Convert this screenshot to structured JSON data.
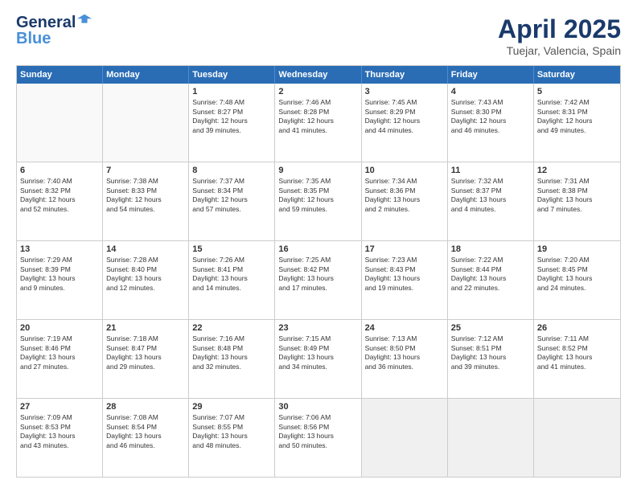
{
  "header": {
    "logo_line1_dark": "General",
    "logo_line2_blue": "Blue",
    "title": "April 2025",
    "subtitle": "Tuejar, Valencia, Spain"
  },
  "calendar": {
    "days": [
      "Sunday",
      "Monday",
      "Tuesday",
      "Wednesday",
      "Thursday",
      "Friday",
      "Saturday"
    ],
    "rows": [
      [
        {
          "day": "",
          "empty": true
        },
        {
          "day": "",
          "empty": true
        },
        {
          "day": "1",
          "lines": [
            "Sunrise: 7:48 AM",
            "Sunset: 8:27 PM",
            "Daylight: 12 hours",
            "and 39 minutes."
          ]
        },
        {
          "day": "2",
          "lines": [
            "Sunrise: 7:46 AM",
            "Sunset: 8:28 PM",
            "Daylight: 12 hours",
            "and 41 minutes."
          ]
        },
        {
          "day": "3",
          "lines": [
            "Sunrise: 7:45 AM",
            "Sunset: 8:29 PM",
            "Daylight: 12 hours",
            "and 44 minutes."
          ]
        },
        {
          "day": "4",
          "lines": [
            "Sunrise: 7:43 AM",
            "Sunset: 8:30 PM",
            "Daylight: 12 hours",
            "and 46 minutes."
          ]
        },
        {
          "day": "5",
          "lines": [
            "Sunrise: 7:42 AM",
            "Sunset: 8:31 PM",
            "Daylight: 12 hours",
            "and 49 minutes."
          ]
        }
      ],
      [
        {
          "day": "6",
          "lines": [
            "Sunrise: 7:40 AM",
            "Sunset: 8:32 PM",
            "Daylight: 12 hours",
            "and 52 minutes."
          ]
        },
        {
          "day": "7",
          "lines": [
            "Sunrise: 7:38 AM",
            "Sunset: 8:33 PM",
            "Daylight: 12 hours",
            "and 54 minutes."
          ]
        },
        {
          "day": "8",
          "lines": [
            "Sunrise: 7:37 AM",
            "Sunset: 8:34 PM",
            "Daylight: 12 hours",
            "and 57 minutes."
          ]
        },
        {
          "day": "9",
          "lines": [
            "Sunrise: 7:35 AM",
            "Sunset: 8:35 PM",
            "Daylight: 12 hours",
            "and 59 minutes."
          ]
        },
        {
          "day": "10",
          "lines": [
            "Sunrise: 7:34 AM",
            "Sunset: 8:36 PM",
            "Daylight: 13 hours",
            "and 2 minutes."
          ]
        },
        {
          "day": "11",
          "lines": [
            "Sunrise: 7:32 AM",
            "Sunset: 8:37 PM",
            "Daylight: 13 hours",
            "and 4 minutes."
          ]
        },
        {
          "day": "12",
          "lines": [
            "Sunrise: 7:31 AM",
            "Sunset: 8:38 PM",
            "Daylight: 13 hours",
            "and 7 minutes."
          ]
        }
      ],
      [
        {
          "day": "13",
          "lines": [
            "Sunrise: 7:29 AM",
            "Sunset: 8:39 PM",
            "Daylight: 13 hours",
            "and 9 minutes."
          ]
        },
        {
          "day": "14",
          "lines": [
            "Sunrise: 7:28 AM",
            "Sunset: 8:40 PM",
            "Daylight: 13 hours",
            "and 12 minutes."
          ]
        },
        {
          "day": "15",
          "lines": [
            "Sunrise: 7:26 AM",
            "Sunset: 8:41 PM",
            "Daylight: 13 hours",
            "and 14 minutes."
          ]
        },
        {
          "day": "16",
          "lines": [
            "Sunrise: 7:25 AM",
            "Sunset: 8:42 PM",
            "Daylight: 13 hours",
            "and 17 minutes."
          ]
        },
        {
          "day": "17",
          "lines": [
            "Sunrise: 7:23 AM",
            "Sunset: 8:43 PM",
            "Daylight: 13 hours",
            "and 19 minutes."
          ]
        },
        {
          "day": "18",
          "lines": [
            "Sunrise: 7:22 AM",
            "Sunset: 8:44 PM",
            "Daylight: 13 hours",
            "and 22 minutes."
          ]
        },
        {
          "day": "19",
          "lines": [
            "Sunrise: 7:20 AM",
            "Sunset: 8:45 PM",
            "Daylight: 13 hours",
            "and 24 minutes."
          ]
        }
      ],
      [
        {
          "day": "20",
          "lines": [
            "Sunrise: 7:19 AM",
            "Sunset: 8:46 PM",
            "Daylight: 13 hours",
            "and 27 minutes."
          ]
        },
        {
          "day": "21",
          "lines": [
            "Sunrise: 7:18 AM",
            "Sunset: 8:47 PM",
            "Daylight: 13 hours",
            "and 29 minutes."
          ]
        },
        {
          "day": "22",
          "lines": [
            "Sunrise: 7:16 AM",
            "Sunset: 8:48 PM",
            "Daylight: 13 hours",
            "and 32 minutes."
          ]
        },
        {
          "day": "23",
          "lines": [
            "Sunrise: 7:15 AM",
            "Sunset: 8:49 PM",
            "Daylight: 13 hours",
            "and 34 minutes."
          ]
        },
        {
          "day": "24",
          "lines": [
            "Sunrise: 7:13 AM",
            "Sunset: 8:50 PM",
            "Daylight: 13 hours",
            "and 36 minutes."
          ]
        },
        {
          "day": "25",
          "lines": [
            "Sunrise: 7:12 AM",
            "Sunset: 8:51 PM",
            "Daylight: 13 hours",
            "and 39 minutes."
          ]
        },
        {
          "day": "26",
          "lines": [
            "Sunrise: 7:11 AM",
            "Sunset: 8:52 PM",
            "Daylight: 13 hours",
            "and 41 minutes."
          ]
        }
      ],
      [
        {
          "day": "27",
          "lines": [
            "Sunrise: 7:09 AM",
            "Sunset: 8:53 PM",
            "Daylight: 13 hours",
            "and 43 minutes."
          ]
        },
        {
          "day": "28",
          "lines": [
            "Sunrise: 7:08 AM",
            "Sunset: 8:54 PM",
            "Daylight: 13 hours",
            "and 46 minutes."
          ]
        },
        {
          "day": "29",
          "lines": [
            "Sunrise: 7:07 AM",
            "Sunset: 8:55 PM",
            "Daylight: 13 hours",
            "and 48 minutes."
          ]
        },
        {
          "day": "30",
          "lines": [
            "Sunrise: 7:06 AM",
            "Sunset: 8:56 PM",
            "Daylight: 13 hours",
            "and 50 minutes."
          ]
        },
        {
          "day": "",
          "empty": true,
          "shaded": true
        },
        {
          "day": "",
          "empty": true,
          "shaded": true
        },
        {
          "day": "",
          "empty": true,
          "shaded": true
        }
      ]
    ]
  }
}
